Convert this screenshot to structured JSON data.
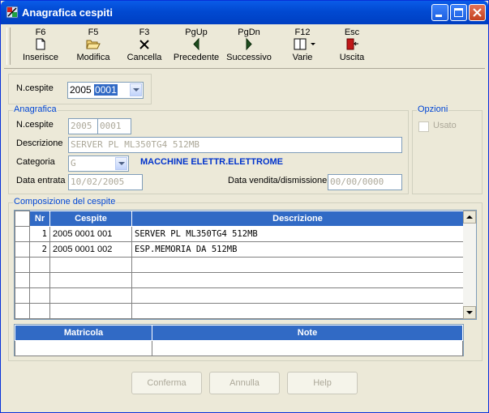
{
  "window": {
    "title": "Anagrafica cespiti"
  },
  "toolbar": [
    {
      "key": "F6",
      "label": "Inserisce",
      "icon": "new-document-icon"
    },
    {
      "key": "F5",
      "label": "Modifica",
      "icon": "open-folder-icon"
    },
    {
      "key": "F3",
      "label": "Cancella",
      "icon": "delete-x-icon"
    },
    {
      "key": "PgUp",
      "label": "Precedente",
      "icon": "arrow-left-icon"
    },
    {
      "key": "PgDn",
      "label": "Successivo",
      "icon": "arrow-right-icon"
    },
    {
      "key": "F12",
      "label": "Varie",
      "icon": "book-dropdown-icon"
    },
    {
      "key": "Esc",
      "label": "Uscita",
      "icon": "exit-door-icon"
    }
  ],
  "search": {
    "label": "N.cespite",
    "year": "2005",
    "number": "0001"
  },
  "anagrafica": {
    "legend": "Anagrafica",
    "ncespite_label": "N.cespite",
    "year": "2005",
    "number": "0001",
    "descrizione_label": "Descrizione",
    "descrizione": "SERVER PL ML350TG4 512MB",
    "categoria_label": "Categoria",
    "categoria": "G",
    "categoria_desc": "MACCHINE ELETTR.ELETTROME",
    "data_entrata_label": "Data entrata",
    "data_entrata": "10/02/2005",
    "data_vendita_label": "Data vendita/dismissione",
    "data_vendita": "00/00/0000"
  },
  "opzioni": {
    "legend": "Opzioni",
    "usato_label": "Usato",
    "usato_checked": false
  },
  "composizione": {
    "legend": "Composizione del cespite",
    "columns": [
      "Nr",
      "Cespite",
      "Descrizione"
    ],
    "rows": [
      {
        "nr": "1",
        "cespite": "2005 0001 001",
        "descrizione": "SERVER PL ML350TG4 512MB"
      },
      {
        "nr": "2",
        "cespite": "2005 0001 002",
        "descrizione": "ESP.MEMORIA DA 512MB"
      }
    ]
  },
  "matricola_table": {
    "columns": [
      "Matricola",
      "Note"
    ]
  },
  "buttons": {
    "conferma": "Conferma",
    "annulla": "Annulla",
    "help": "Help"
  },
  "colors": {
    "titlebar": "#0149d1",
    "header": "#316ac5",
    "legend": "#0046d5",
    "category_text": "#0033cc"
  }
}
